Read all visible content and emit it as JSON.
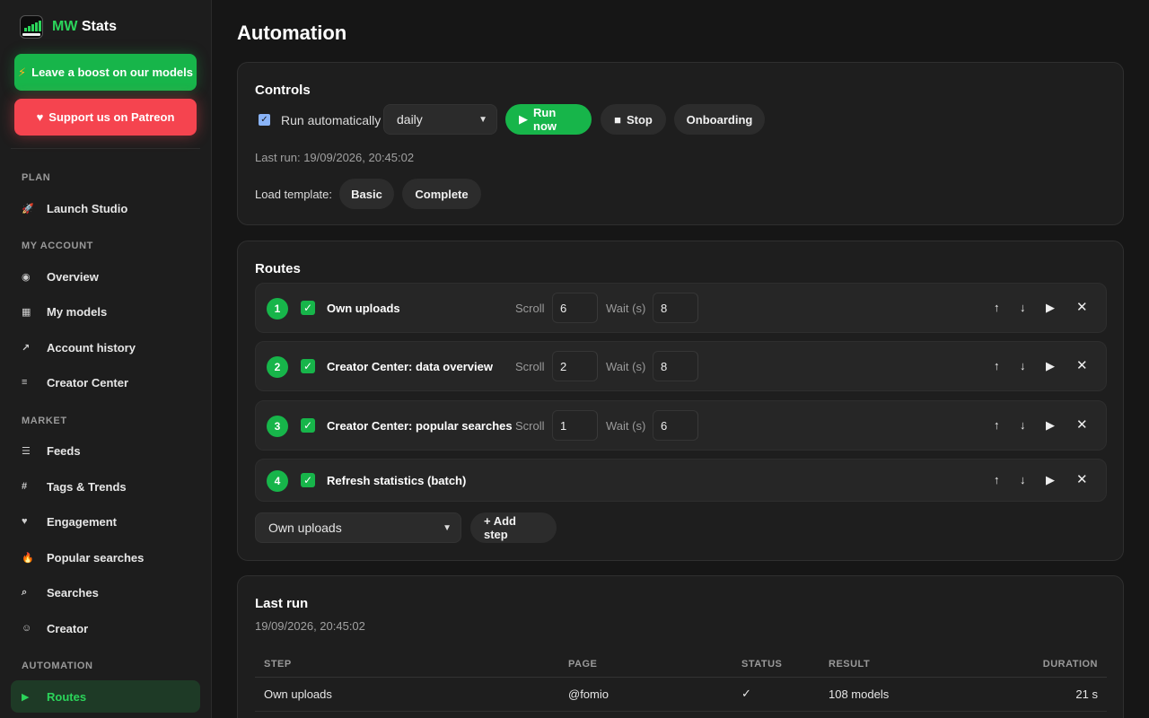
{
  "sidebar": {
    "brand": {
      "prefix": "MW",
      "suffix": " Stats",
      "logo_icon": "bar-chart-logo"
    },
    "boost_label": "Leave a boost on our models",
    "patreon_label": "Support us on Patreon",
    "sections": [
      {
        "label": "PLAN",
        "items": [
          {
            "label": "Launch Studio",
            "icon": "rocket-icon"
          }
        ]
      },
      {
        "label": "MY ACCOUNT",
        "items": [
          {
            "label": "Overview",
            "icon": "gauge-icon"
          },
          {
            "label": "My models",
            "icon": "grid-icon"
          },
          {
            "label": "Account history",
            "icon": "trend-up-icon"
          },
          {
            "label": "Creator Center",
            "icon": "list-icon"
          }
        ]
      },
      {
        "label": "MARKET",
        "items": [
          {
            "label": "Feeds",
            "icon": "menu-icon"
          },
          {
            "label": "Tags & Trends",
            "icon": "hashtag-icon"
          },
          {
            "label": "Engagement",
            "icon": "heart-icon"
          },
          {
            "label": "Popular searches",
            "icon": "fire-icon"
          },
          {
            "label": "Searches",
            "icon": "search-icon"
          },
          {
            "label": "Creator",
            "icon": "smiley-icon"
          }
        ]
      },
      {
        "label": "AUTOMATION",
        "items": [
          {
            "label": "Routes",
            "icon": "play-icon",
            "active": true
          }
        ]
      }
    ]
  },
  "page": {
    "title": "Automation"
  },
  "controls": {
    "title": "Controls",
    "run_auto_label": "Run automatically",
    "run_auto_checked": true,
    "frequency": "daily",
    "run_now": "Run now",
    "stop": "Stop",
    "onboarding": "Onboarding",
    "last_run": "Last run: 19/09/2026, 20:45:02",
    "template_label": "Load template:",
    "template_basic": "Basic",
    "template_complete": "Complete"
  },
  "routes": {
    "title": "Routes",
    "scroll_label": "Scroll",
    "wait_label": "Wait (s)",
    "items": [
      {
        "num": "1",
        "name": "Own uploads",
        "scroll": "6",
        "wait": "8",
        "enabled": true
      },
      {
        "num": "2",
        "name": "Creator Center: data overview",
        "scroll": "2",
        "wait": "8",
        "enabled": true
      },
      {
        "num": "3",
        "name": "Creator Center: popular searches",
        "scroll": "1",
        "wait": "6",
        "enabled": true
      },
      {
        "num": "4",
        "name": "Refresh statistics (batch)",
        "enabled": true
      }
    ],
    "add_select": "Own uploads",
    "add_step": "+ Add step"
  },
  "last_run": {
    "title": "Last run",
    "timestamp": "19/09/2026, 20:45:02",
    "columns": [
      "STEP",
      "PAGE",
      "STATUS",
      "RESULT",
      "DURATION"
    ],
    "rows": [
      {
        "step": "Own uploads",
        "page": "@fomio",
        "status": "✓",
        "result": "108 models",
        "duration": "21 s"
      }
    ]
  },
  "colors": {
    "accent": "#17b54a",
    "patreon": "#f5444f",
    "background": "#161616",
    "card": "#1e1e1e"
  }
}
